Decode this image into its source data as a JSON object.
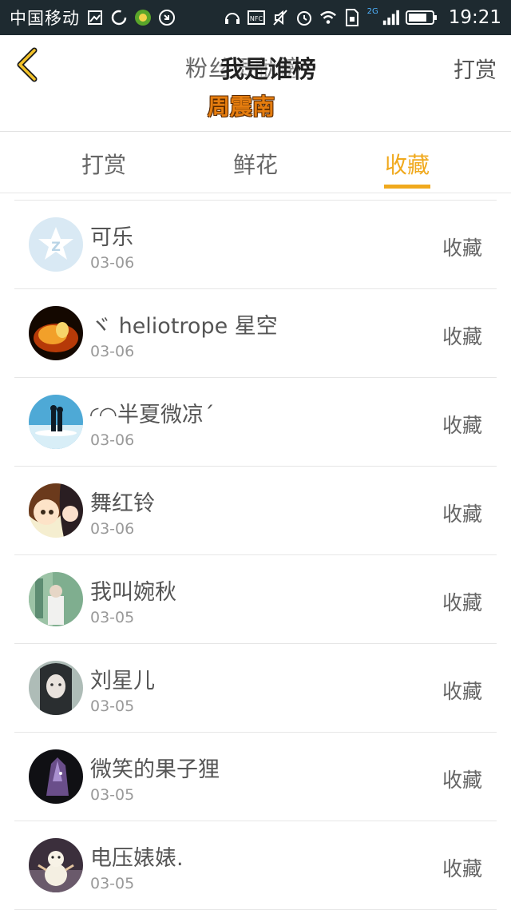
{
  "status_bar": {
    "carrier": "中国移动",
    "network_tag": "2G",
    "time": "19:21"
  },
  "header": {
    "title": "粉丝贡献榜",
    "overlay_title": "我是谁榜",
    "overlay_name": "周震南",
    "right_action": "打赏"
  },
  "tabs": [
    {
      "label": "打赏",
      "active": false
    },
    {
      "label": "鲜花",
      "active": false
    },
    {
      "label": "收藏",
      "active": true
    }
  ],
  "colors": {
    "accent": "#f0a91d",
    "status_bar": "#1e2a30",
    "overlay_name": "#e57d0f"
  },
  "list": [
    {
      "name": "可乐",
      "date": "03-06",
      "action": "收藏",
      "avatar": "qq-default"
    },
    {
      "name": "ヾ heliotrope 星空",
      "date": "03-06",
      "action": "收藏",
      "avatar": "fire-love"
    },
    {
      "name": "◜◠半夏微凉ˊ",
      "date": "03-06",
      "action": "收藏",
      "avatar": "couple-sea"
    },
    {
      "name": "舞红铃",
      "date": "03-06",
      "action": "收藏",
      "avatar": "anime-girls"
    },
    {
      "name": "我叫婉秋",
      "date": "03-05",
      "action": "收藏",
      "avatar": "girl-green"
    },
    {
      "name": "刘星儿",
      "date": "03-05",
      "action": "收藏",
      "avatar": "girl-portrait"
    },
    {
      "name": "微笑的果子狸",
      "date": "03-05",
      "action": "收藏",
      "avatar": "crystal-dark"
    },
    {
      "name": "电压婊婊.",
      "date": "03-05",
      "action": "收藏",
      "avatar": "snowman"
    }
  ]
}
